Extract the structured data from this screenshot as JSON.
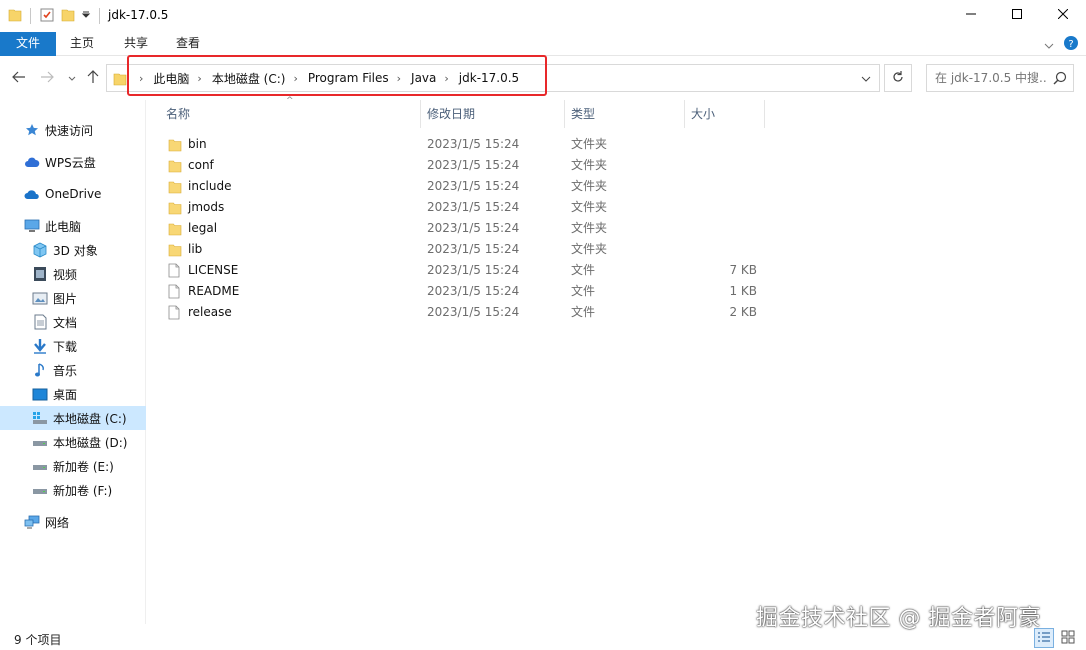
{
  "window": {
    "title": "jdk-17.0.5",
    "minimize_icon": "minimize-icon",
    "maximize_icon": "maximize-icon",
    "close_icon": "close-icon"
  },
  "ribbon": {
    "tabs": [
      "文件",
      "主页",
      "共享",
      "查看"
    ],
    "accent": "#1979ca"
  },
  "address": {
    "crumbs": [
      "此电脑",
      "本地磁盘 (C:)",
      "Program Files",
      "Java",
      "jdk-17.0.5"
    ],
    "highlight_color": "#e8282a"
  },
  "search": {
    "placeholder": "在 jdk-17.0.5 中搜..."
  },
  "sidebar": {
    "items": [
      {
        "label": "快速访问",
        "icon": "star-icon"
      },
      {
        "label": "WPS云盘",
        "icon": "cloud-icon"
      },
      {
        "label": "OneDrive",
        "icon": "onedrive-icon"
      },
      {
        "label": "此电脑",
        "icon": "computer-icon"
      },
      {
        "label": "3D 对象",
        "icon": "cube-icon"
      },
      {
        "label": "视频",
        "icon": "video-icon"
      },
      {
        "label": "图片",
        "icon": "picture-icon"
      },
      {
        "label": "文档",
        "icon": "document-icon"
      },
      {
        "label": "下载",
        "icon": "download-icon"
      },
      {
        "label": "音乐",
        "icon": "music-icon"
      },
      {
        "label": "桌面",
        "icon": "desktop-icon"
      },
      {
        "label": "本地磁盘 (C:)",
        "icon": "drive-icon",
        "selected": true
      },
      {
        "label": "本地磁盘 (D:)",
        "icon": "drive-icon"
      },
      {
        "label": "新加卷 (E:)",
        "icon": "drive-icon"
      },
      {
        "label": "新加卷 (F:)",
        "icon": "drive-icon"
      },
      {
        "label": "网络",
        "icon": "network-icon"
      }
    ]
  },
  "columns": {
    "name": "名称",
    "date": "修改日期",
    "type": "类型",
    "size": "大小"
  },
  "files": [
    {
      "name": "bin",
      "date": "2023/1/5 15:24",
      "type": "文件夹",
      "size": "",
      "kind": "folder"
    },
    {
      "name": "conf",
      "date": "2023/1/5 15:24",
      "type": "文件夹",
      "size": "",
      "kind": "folder"
    },
    {
      "name": "include",
      "date": "2023/1/5 15:24",
      "type": "文件夹",
      "size": "",
      "kind": "folder"
    },
    {
      "name": "jmods",
      "date": "2023/1/5 15:24",
      "type": "文件夹",
      "size": "",
      "kind": "folder"
    },
    {
      "name": "legal",
      "date": "2023/1/5 15:24",
      "type": "文件夹",
      "size": "",
      "kind": "folder"
    },
    {
      "name": "lib",
      "date": "2023/1/5 15:24",
      "type": "文件夹",
      "size": "",
      "kind": "folder"
    },
    {
      "name": "LICENSE",
      "date": "2023/1/5 15:24",
      "type": "文件",
      "size": "7 KB",
      "kind": "file"
    },
    {
      "name": "README",
      "date": "2023/1/5 15:24",
      "type": "文件",
      "size": "1 KB",
      "kind": "file"
    },
    {
      "name": "release",
      "date": "2023/1/5 15:24",
      "type": "文件",
      "size": "2 KB",
      "kind": "file"
    }
  ],
  "status": {
    "item_count": "9 个项目"
  },
  "watermark": "掘金技术社区 @ 掘金者阿豪"
}
